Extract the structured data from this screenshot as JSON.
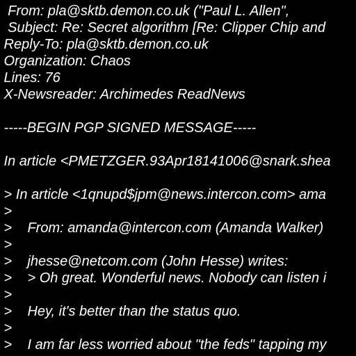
{
  "colors": {
    "background": "#000000",
    "text": "#ffffff"
  },
  "message": {
    "lines": [
      "  From: pla@sktb.demon.co.uk (\"Paul L. Allen\",",
      "  Subject: Re: Secret algorithm [Re: Clipper Chip and",
      " Reply-To: pla@sktb.demon.co.uk",
      " Organization: Chaos",
      " Lines: 76",
      " X-Newsreader: Archimedes ReadNews",
      "",
      " -----BEGIN PGP SIGNED MESSAGE-----",
      "",
      " In article <PMETZGER.93Apr18141006@snark.shea",
      "",
      " > In article <1qnupd$jpm@news.intercon.com> ama",
      " >",
      " >    From: amanda@intercon.com (Amanda Walker)",
      " >",
      " >    jhesse@netcom.com (John Hesse) writes:",
      " >    > Oh great. Wonderful news. Nobody can listen i",
      " >",
      " >    Hey, it's better than the status quo.",
      " >",
      " >    I am far less worried about \"the feds\" tapping my"
    ]
  }
}
